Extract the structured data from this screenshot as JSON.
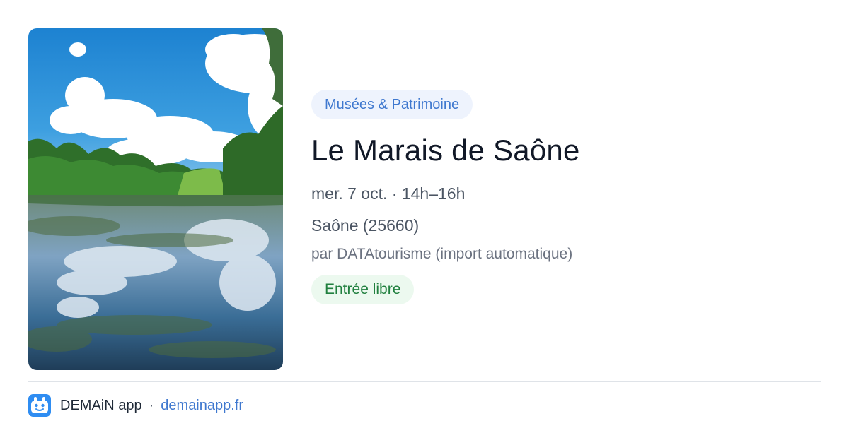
{
  "event": {
    "category": "Musées & Patrimoine",
    "title": "Le Marais de Saône",
    "datetime": "mer. 7 oct. · 14h–16h",
    "location": "Saône (25660)",
    "source": "par DATAtourisme (import automatique)",
    "price": "Entrée libre",
    "image_icon": "lake-landscape-photo"
  },
  "footer": {
    "app_name": "DEMAiN app",
    "separator": "·",
    "link": "demainapp.fr",
    "logo_icon": "demain-app-logo-icon"
  },
  "colors": {
    "category_text": "#3f78cf",
    "category_bg": "#eef3fd",
    "price_text": "#21803f",
    "price_bg": "#ecf9ef",
    "title": "#111827",
    "link": "#3f78cf",
    "logo_bg": "#2f8df2"
  }
}
